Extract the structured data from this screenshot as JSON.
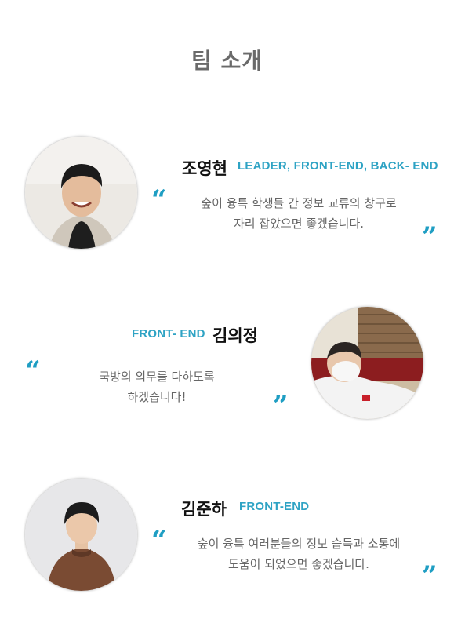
{
  "page": {
    "title": "팀 소개"
  },
  "members": [
    {
      "name": "조영현",
      "role": "LEADER, FRONT-END, BACK- END",
      "quote_line1": "숲이 융특 학생들 간 정보 교류의 창구로",
      "quote_line2": "자리 잡았으면 좋겠습니다."
    },
    {
      "name": "김의정",
      "role": "FRONT- END",
      "quote_line1": "국방의 의무를 다하도록",
      "quote_line2": "하겠습니다!"
    },
    {
      "name": "김준하",
      "role": "FRONT-END",
      "quote_line1": "숲이 융특 여러분들의 정보 습득과 소통에",
      "quote_line2": "도움이 되었으면 좋겠습니다."
    }
  ],
  "quote_marks": {
    "open": "“",
    "close": "”"
  },
  "colors": {
    "accent": "#2ea3c4",
    "title": "#6a6a6a",
    "text": "#666666"
  }
}
